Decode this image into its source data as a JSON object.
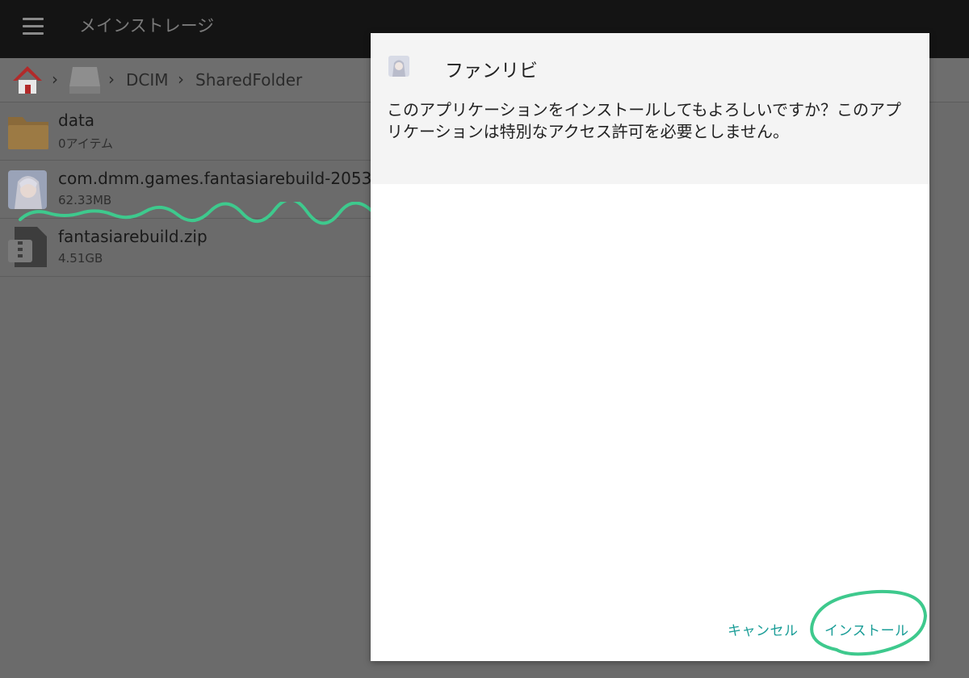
{
  "topbar": {
    "title": "メインストレージ"
  },
  "breadcrumb": {
    "crumbs": [
      "DCIM",
      "SharedFolder"
    ]
  },
  "files": [
    {
      "name": "data",
      "meta": "0アイテム",
      "icon": "folder-icon"
    },
    {
      "name": "com.dmm.games.fantasiarebuild-2053",
      "meta": "62.33MB",
      "icon": "app-thumbnail-icon"
    },
    {
      "name": "fantasiarebuild.zip",
      "meta": "4.51GB",
      "icon": "zip-file-icon"
    }
  ],
  "dialog": {
    "title": "ファンリビ",
    "message": "このアプリケーションをインストールしてもよろしいですか？このアプリケーションは特別なアクセス許可を必要としません。",
    "cancel_label": "キャンセル",
    "install_label": "インストール"
  },
  "colors": {
    "topbar": "#141414",
    "dim_background": "#6b6b6b",
    "accent": "#1a9d97",
    "annotation": "#3ec98d"
  }
}
